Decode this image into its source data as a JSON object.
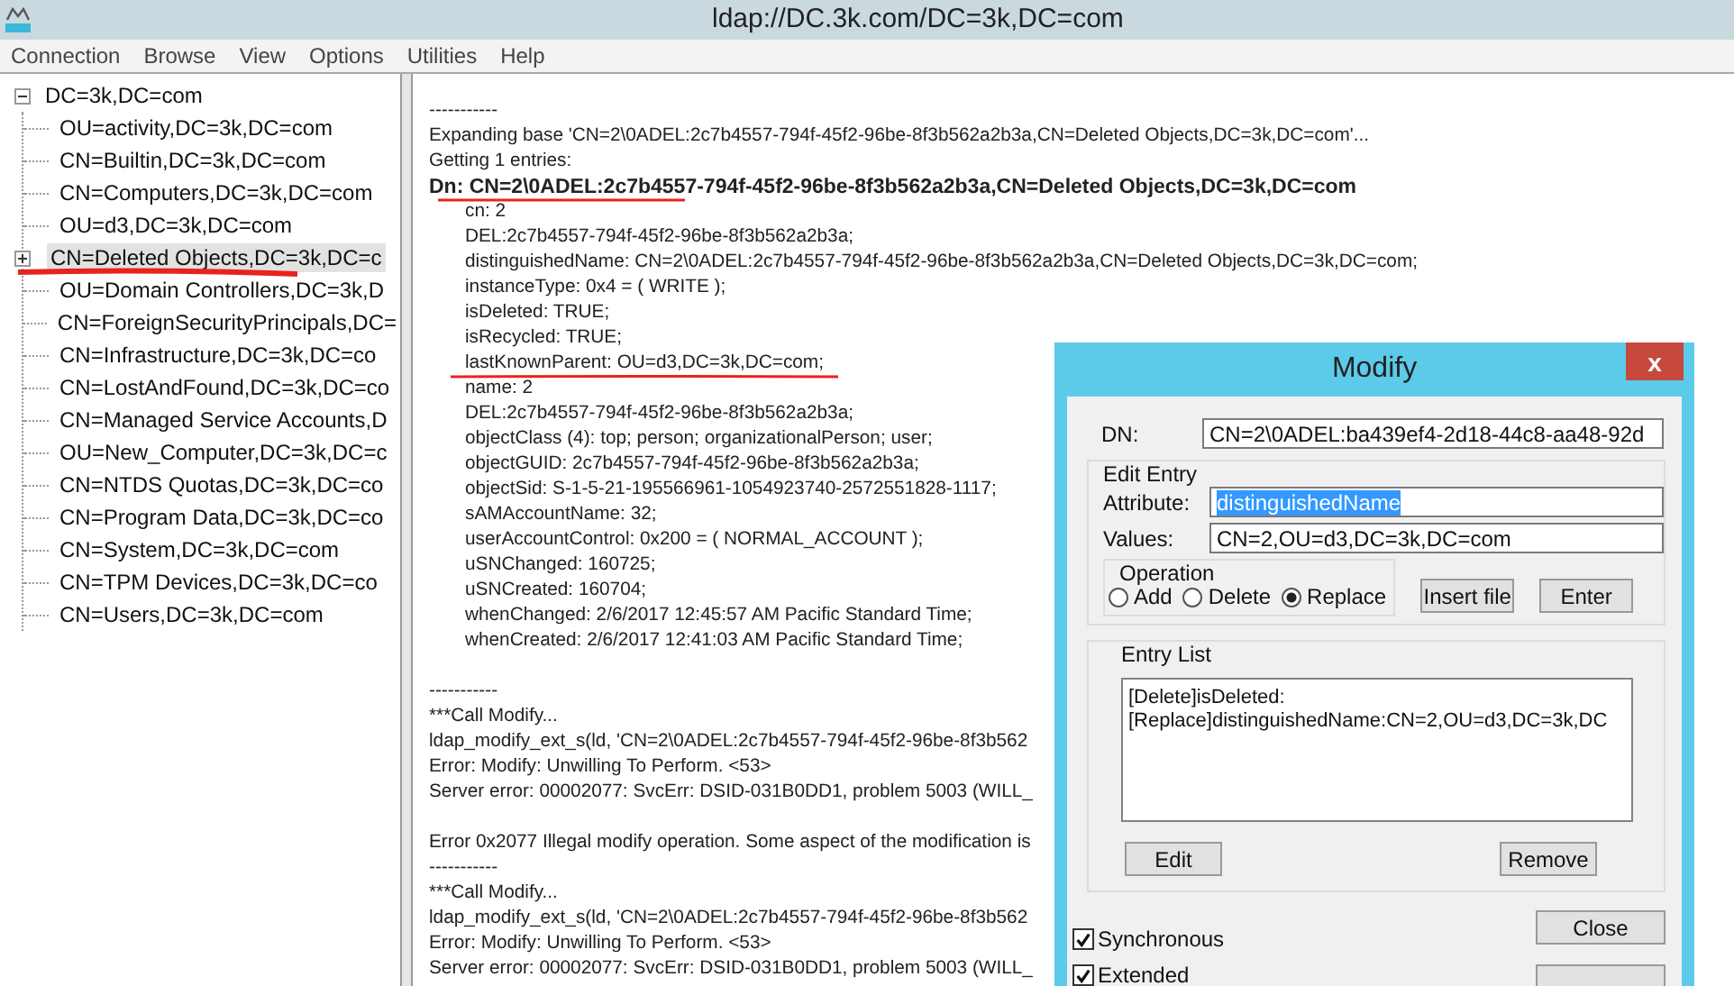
{
  "window": {
    "title": "ldap://DC.3k.com/DC=3k,DC=com"
  },
  "menu": [
    "Connection",
    "Browse",
    "View",
    "Options",
    "Utilities",
    "Help"
  ],
  "tree": {
    "label": "DC=3k,DC=com",
    "expanded": true,
    "children": [
      {
        "label": "OU=activity,DC=3k,DC=com",
        "selected": false,
        "expandable": false
      },
      {
        "label": "CN=Builtin,DC=3k,DC=com",
        "selected": false,
        "expandable": false
      },
      {
        "label": "CN=Computers,DC=3k,DC=com",
        "selected": false,
        "expandable": false
      },
      {
        "label": "OU=d3,DC=3k,DC=com",
        "selected": false,
        "expandable": false
      },
      {
        "label": "CN=Deleted Objects,DC=3k,DC=c",
        "selected": true,
        "expandable": true
      },
      {
        "label": "OU=Domain Controllers,DC=3k,D",
        "selected": false,
        "expandable": false
      },
      {
        "label": "CN=ForeignSecurityPrincipals,DC=",
        "selected": false,
        "expandable": false
      },
      {
        "label": "CN=Infrastructure,DC=3k,DC=co",
        "selected": false,
        "expandable": false
      },
      {
        "label": "CN=LostAndFound,DC=3k,DC=co",
        "selected": false,
        "expandable": false
      },
      {
        "label": "CN=Managed Service Accounts,D",
        "selected": false,
        "expandable": false
      },
      {
        "label": "OU=New_Computer,DC=3k,DC=c",
        "selected": false,
        "expandable": false
      },
      {
        "label": "CN=NTDS Quotas,DC=3k,DC=co",
        "selected": false,
        "expandable": false
      },
      {
        "label": "CN=Program Data,DC=3k,DC=co",
        "selected": false,
        "expandable": false
      },
      {
        "label": "CN=System,DC=3k,DC=com",
        "selected": false,
        "expandable": false
      },
      {
        "label": "CN=TPM Devices,DC=3k,DC=co",
        "selected": false,
        "expandable": false
      },
      {
        "label": "CN=Users,DC=3k,DC=com",
        "selected": false,
        "expandable": false
      }
    ]
  },
  "output": [
    {
      "kind": "plain",
      "text": "-----------"
    },
    {
      "kind": "plain",
      "text": "Expanding base 'CN=2\\0ADEL:2c7b4557-794f-45f2-96be-8f3b562a2b3a,CN=Deleted Objects,DC=3k,DC=com'..."
    },
    {
      "kind": "plain",
      "text": "Getting 1 entries:"
    },
    {
      "kind": "heading",
      "text": "Dn: CN=2\\0ADEL:2c7b4557-794f-45f2-96be-8f3b562a2b3a,CN=Deleted Objects,DC=3k,DC=com"
    },
    {
      "kind": "attribute",
      "text": "cn: 2"
    },
    {
      "kind": "attribute",
      "text": "DEL:2c7b4557-794f-45f2-96be-8f3b562a2b3a;"
    },
    {
      "kind": "attribute",
      "text": "distinguishedName: CN=2\\0ADEL:2c7b4557-794f-45f2-96be-8f3b562a2b3a,CN=Deleted Objects,DC=3k,DC=com;"
    },
    {
      "kind": "attribute",
      "text": "instanceType: 0x4 = ( WRITE );"
    },
    {
      "kind": "attribute",
      "text": "isDeleted: TRUE;"
    },
    {
      "kind": "attribute",
      "text": "isRecycled: TRUE;"
    },
    {
      "kind": "attribute",
      "text": "lastKnownParent: OU=d3,DC=3k,DC=com;"
    },
    {
      "kind": "attribute",
      "text": "name: 2"
    },
    {
      "kind": "attribute",
      "text": "DEL:2c7b4557-794f-45f2-96be-8f3b562a2b3a;"
    },
    {
      "kind": "attribute",
      "text": "objectClass (4): top; person; organizationalPerson; user;"
    },
    {
      "kind": "attribute",
      "text": "objectGUID: 2c7b4557-794f-45f2-96be-8f3b562a2b3a;"
    },
    {
      "kind": "attribute",
      "text": "objectSid: S-1-5-21-195566961-1054923740-2572551828-1117;"
    },
    {
      "kind": "attribute",
      "text": "sAMAccountName: 32;"
    },
    {
      "kind": "attribute",
      "text": "userAccountControl: 0x200 = ( NORMAL_ACCOUNT );"
    },
    {
      "kind": "attribute",
      "text": "uSNChanged: 160725;"
    },
    {
      "kind": "attribute",
      "text": "uSNCreated: 160704;"
    },
    {
      "kind": "attribute",
      "text": "whenChanged: 2/6/2017 12:45:57 AM Pacific Standard Time;"
    },
    {
      "kind": "attribute",
      "text": "whenCreated: 2/6/2017 12:41:03 AM Pacific Standard Time;"
    },
    {
      "kind": "gap"
    },
    {
      "kind": "plain",
      "text": "-----------"
    },
    {
      "kind": "plain",
      "text": "***Call Modify..."
    },
    {
      "kind": "plain",
      "text": "ldap_modify_ext_s(ld, 'CN=2\\0ADEL:2c7b4557-794f-45f2-96be-8f3b562"
    },
    {
      "kind": "plain",
      "text": "Error: Modify: Unwilling To Perform. <53>"
    },
    {
      "kind": "plain",
      "text": "Server error: 00002077: SvcErr: DSID-031B0DD1, problem 5003 (WILL_"
    },
    {
      "kind": "gap"
    },
    {
      "kind": "plain",
      "text": "Error 0x2077 Illegal modify operation. Some aspect of the modification is"
    },
    {
      "kind": "plain",
      "text": "-----------"
    },
    {
      "kind": "plain",
      "text": "***Call Modify..."
    },
    {
      "kind": "plain",
      "text": "ldap_modify_ext_s(ld, 'CN=2\\0ADEL:2c7b4557-794f-45f2-96be-8f3b562"
    },
    {
      "kind": "plain",
      "text": "Error: Modify: Unwilling To Perform. <53>"
    },
    {
      "kind": "plain",
      "text": "Server error: 00002077: SvcErr: DSID-031B0DD1, problem 5003 (WILL_"
    }
  ],
  "dialog": {
    "title": "Modify",
    "close": "x",
    "dn_label": "DN:",
    "dn": "CN=2\\0ADEL:ba439ef4-2d18-44c8-aa48-92d",
    "edit_group": "Edit Entry",
    "attribute_label": "Attribute:",
    "attribute": "distinguishedName",
    "attribute_selected": true,
    "values_label": "Values:",
    "values": "CN=2,OU=d3,DC=3k,DC=com",
    "operation_label": "Operation",
    "operations": [
      {
        "label": "Add",
        "selected": false
      },
      {
        "label": "Delete",
        "selected": false
      },
      {
        "label": "Replace",
        "selected": true
      }
    ],
    "insert_button": "Insert file",
    "enter_button": "Enter",
    "entry_list_label": "Entry List",
    "entries": [
      "[Delete]isDeleted:",
      "[Replace]distinguishedName:CN=2,OU=d3,DC=3k,DC"
    ],
    "edit_button": "Edit",
    "remove_button": "Remove",
    "options": [
      {
        "label": "Synchronous",
        "checked": true
      },
      {
        "label": "Extended",
        "checked": true
      }
    ],
    "close_button": "Close"
  }
}
